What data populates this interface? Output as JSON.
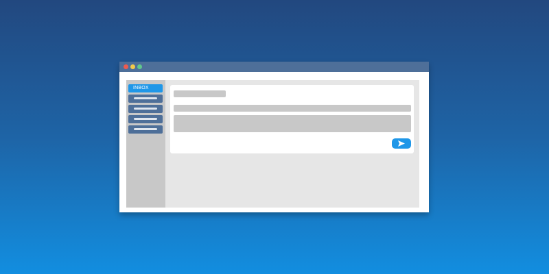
{
  "window": {
    "controls": [
      "close",
      "minimize",
      "maximize"
    ]
  },
  "sidebar": {
    "items": [
      {
        "label": "INBOX",
        "active": true
      },
      {
        "label": "",
        "active": false
      },
      {
        "label": "",
        "active": false
      },
      {
        "label": "",
        "active": false
      },
      {
        "label": "",
        "active": false
      }
    ]
  },
  "compose": {
    "send_icon": "send-icon"
  },
  "colors": {
    "accent": "#1f97e8",
    "titlebar": "#4e6f99",
    "placeholder": "#c8c8c8"
  }
}
